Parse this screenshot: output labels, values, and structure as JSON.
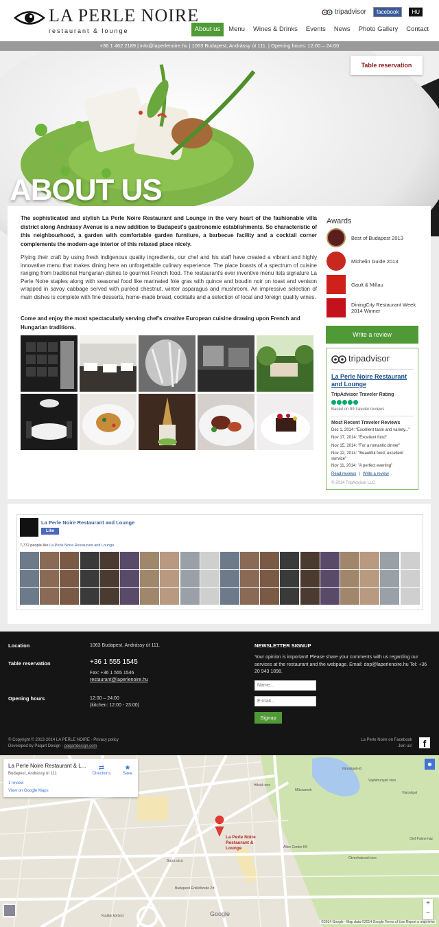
{
  "header": {
    "logo_title": "LA PERLE NOIRE",
    "logo_subtitle": "restaurant & lounge",
    "tripadvisor": "tripadvisor",
    "facebook": "facebook",
    "language": "HU",
    "nav": [
      {
        "label": "About us",
        "active": true
      },
      {
        "label": "Menu"
      },
      {
        "label": "Wines & Drinks"
      },
      {
        "label": "Events"
      },
      {
        "label": "News"
      },
      {
        "label": "Photo Gallery"
      },
      {
        "label": "Contact"
      }
    ]
  },
  "infobar": "+36 1 462 2189  |  info@laperlenoire.hu  |  1063 Budapest, Andrássy út 111.  |  Opening hours: 12:00 – 24:00",
  "reservation_button": "Table reservation",
  "page_title": "ABOUT US",
  "content": {
    "intro": "The sophisticated and stylish La Perle Noire Restaurant and Lounge in the very heart of the fashionable villa district along Andrássy Avenue is a new addition to Budapest's gastronomic establishments. So characteristic of this neighbourhood, a garden with comfortable garden furniture, a barbecue facility and a cocktail corner complements the modern-age interior of this relaxed place nicely.",
    "body": "Plying their craft by using fresh indigenous quality ingredients, our chef and his staff have created a vibrant and highly innovative menu that makes dining here an unforgettable culinary experience. The place boasts of a spectrum of cuisine ranging from traditional Hungarian dishes to gourmet French food. The restaurant's ever inventive menu lists signature La Perle Noire staples along with seasonal food like marinated foie gras with quince and boudin noir on toast and venison wrapped in savoy cabbage served with puréed chestnut, winter asparagus and mushroom. An impressive selection of main dishes is complete with fine desserts, home-made bread, cocktails and a selection of local and foreign quality wines.",
    "closing": "Come and enjoy the most spectacularly serving chef's creative European cuisine drawing upon French and Hungarian traditions."
  },
  "awards": {
    "title": "Awards",
    "items": [
      {
        "label": "Best of Budapest 2013",
        "icon": "best-of-budapest-badge-icon",
        "color": "#5a1e1e"
      },
      {
        "label": "Michelin Guide 2013",
        "icon": "michelin-badge-icon",
        "color": "#c8281e"
      },
      {
        "label": "Gault & Millau",
        "icon": "gault-millau-badge-icon",
        "color": "#d0201a"
      },
      {
        "label": "DiningCity Restaurant Week 2014 Winner",
        "icon": "diningcity-badge-icon",
        "color": "#c4121c"
      }
    ]
  },
  "write_review": "Write a review",
  "tripadvisor_widget": {
    "logo": "tripadvisor",
    "name": "La Perle Noire Restaurant and Lounge",
    "rating_label": "TripAdvisor Traveler Rating",
    "rating": 5,
    "based_on": "Based on 89 traveler reviews",
    "recent_title": "Most Recent Traveler Reviews",
    "reviews": [
      "Dec 1, 2014: \"Excellent taste and variety...\"",
      "Nov 17, 2014: \"Excellent food\"",
      "Nov 15, 2014: \"For a romantic dinner\"",
      "Nov 12, 2014: \"Beautiful food, excellent swrvice\"",
      "Nov 11, 2014: \"A perfect evening\""
    ],
    "read_reviews": "Read reviews",
    "write_link": "Write a review",
    "copyright": "© 2014 TripAdvisor LLC"
  },
  "facebook_box": {
    "page_name": "La Perle Noire Restaurant and Lounge",
    "like": "Like",
    "count_prefix": "7,772 people like ",
    "count_link": "La Perle Noire Restaurant and Lounge",
    "count_suffix": "."
  },
  "footer": {
    "location_label": "Location",
    "location_value": "1063 Budapest, Andrássy út 111.",
    "reservation_label": "Table reservation",
    "phone": "+36 1 555 1545",
    "fax": "Fax: +36 1 555 1546",
    "email": "restaurant@laperlenoire.hu",
    "hours_label": "Opening hours",
    "hours_value": "12:00 – 24:00",
    "kitchen_hours": "(kitchen: 12:00 - 23:00)",
    "newsletter_title": "NEWSLETTER SIGNUP",
    "newsletter_text": "Your opinion is important! Please share your comments with us regarding our services at the restaurant and the webpage. Email: dop@laperlenoire.hu Tel: +36 20 943 1898.",
    "name_placeholder": "Name...",
    "email_placeholder": "E-mail...",
    "signup": "Signup",
    "copyright": "© Copyright © 2013-2014 LA PERLE NOIRE - Privacy policy",
    "developer_prefix": "Developed by Paqart Design - ",
    "developer_link": "paqartdesign.com",
    "facebook_label": "La Perle Noire on Facebook",
    "join": "Join us!"
  },
  "map": {
    "place_title": "La Perle Noire Restaurant & L...",
    "address": "Budapest, Andrássy út 111",
    "reviews": "1 review",
    "view_link": "View on Google Maps",
    "directions": "Directions",
    "save": "Save",
    "pin_label": "La Perle Noire Restaurant & Lounge",
    "google": "Google",
    "credits": "©2014 Google - Map data ©2014 Google   Terms of Use   Report a map error",
    "labels": {
      "hosok": "Hősök tere",
      "mucsarnok": "Műcsarnok",
      "varosliget": "Városliget",
      "bajza": "Bajza utca",
      "kodaly": "Kodály körönd",
      "allee": "Allee Center Kft",
      "ertekt": "Budapesti Értéktőzsde Zrt.",
      "olof": "Olof Palme ház",
      "vajdahunyad": "Vajdahunyad vára",
      "varosligeti": "Városligeti-tó",
      "ovenhetes": "Ötvenhatosok tere"
    }
  }
}
